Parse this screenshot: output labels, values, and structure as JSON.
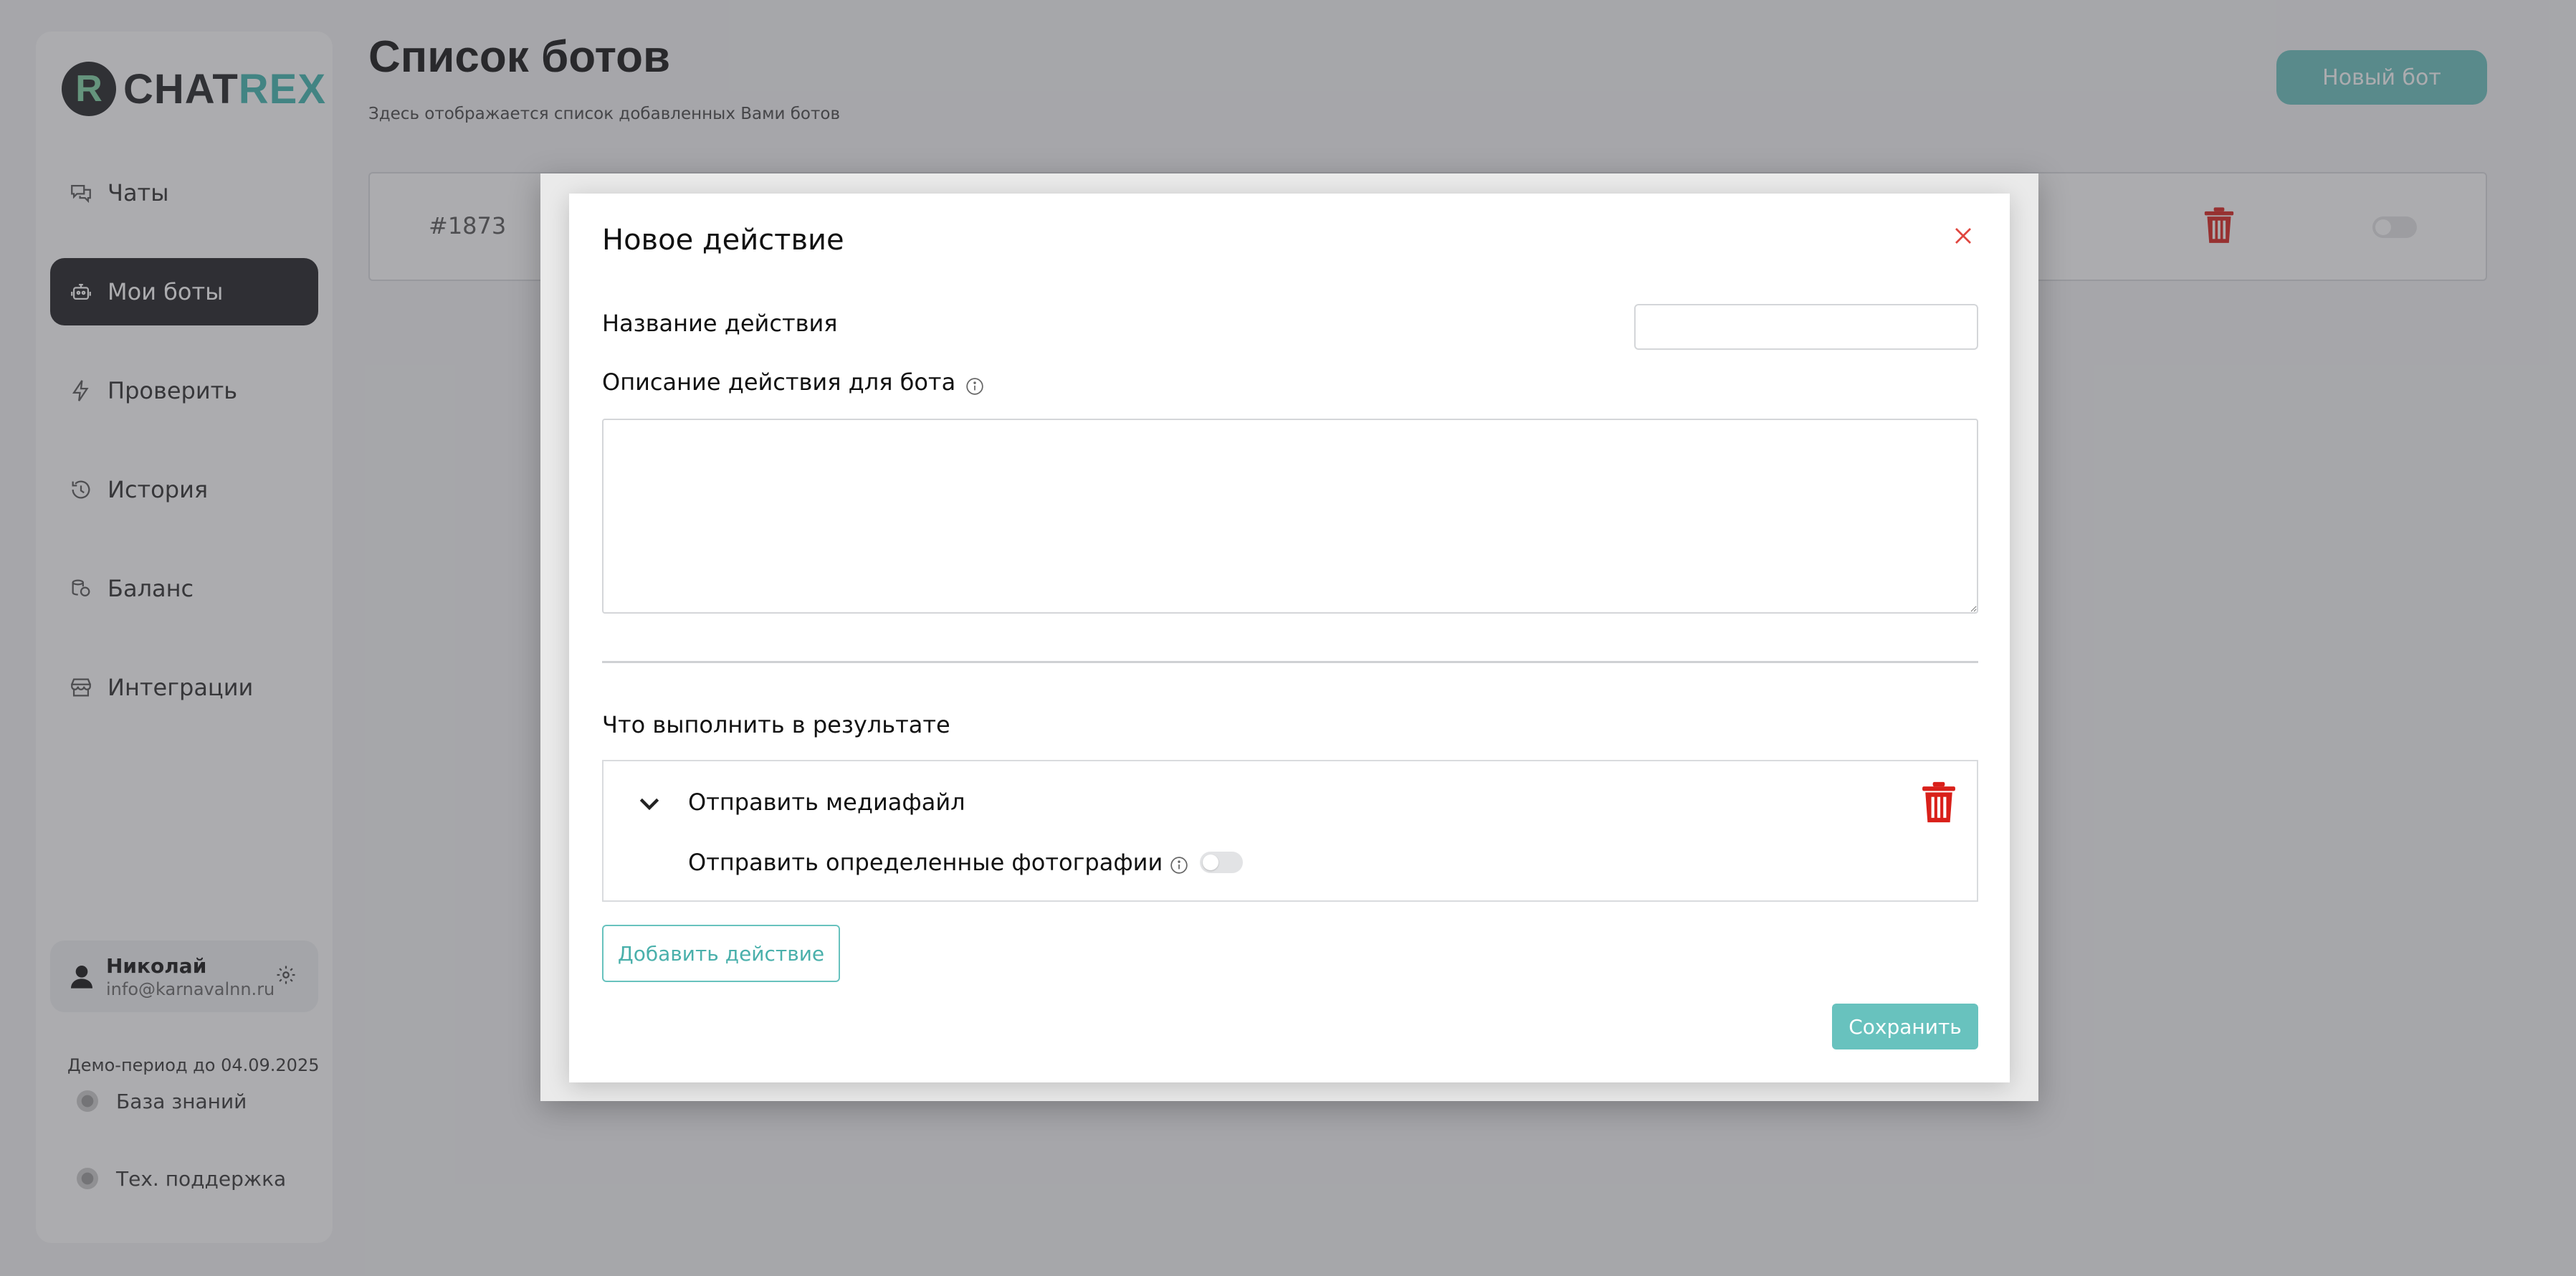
{
  "app": {
    "logo_letter": "R",
    "logo_chat": "CHAT",
    "logo_rex": "REX",
    "accent": "#68c2be",
    "danger": "#d9201a"
  },
  "sidebar": {
    "items": [
      {
        "label": "Чаты",
        "icon": "chats-icon"
      },
      {
        "label": "Мои боты",
        "icon": "bots-icon",
        "active": true
      },
      {
        "label": "Проверить",
        "icon": "lightning-icon"
      },
      {
        "label": "История",
        "icon": "history-icon"
      },
      {
        "label": "Баланс",
        "icon": "coins-icon"
      },
      {
        "label": "Интеграции",
        "icon": "store-icon"
      }
    ],
    "user": {
      "name": "Николай",
      "email": "info@karnavalnn.ru"
    },
    "demo_text": "Демо-период до 04.09.2025",
    "knowledge_base": "База знаний",
    "support": "Тех. поддержка"
  },
  "main": {
    "title": "Список ботов",
    "subtitle": "Здесь отображается список добавленных Вами ботов",
    "new_bot_label": "Новый бот",
    "bot_row": {
      "id": "#1873"
    }
  },
  "modal": {
    "title": "Новое действие",
    "name_label": "Название действия",
    "name_value": "",
    "description_label": "Описание действия для бота",
    "description_value": "",
    "result_label": "Что выполнить в результате",
    "action": {
      "name": "Отправить медиафайл",
      "option_label": "Отправить определенные фотографии",
      "option_enabled": false
    },
    "add_action_label": "Добавить действие",
    "save_label": "Сохранить"
  }
}
